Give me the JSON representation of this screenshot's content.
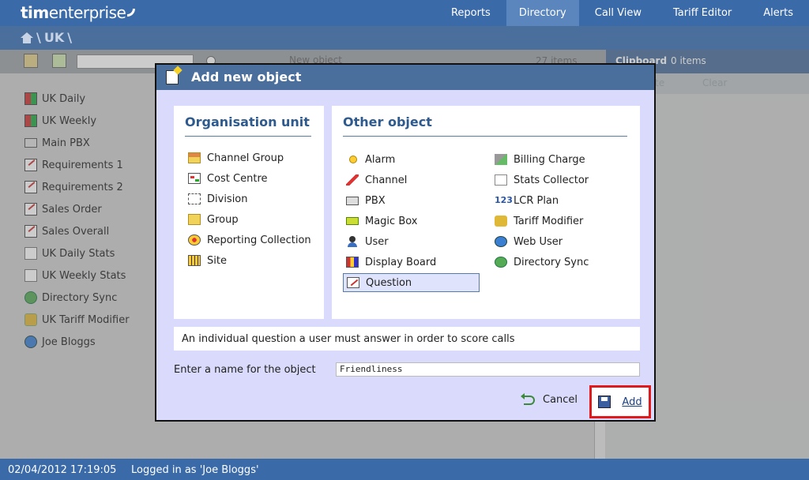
{
  "app": {
    "logo_bold": "tim",
    "logo_light": "enterprise"
  },
  "nav": [
    {
      "label": "Reports",
      "active": false
    },
    {
      "label": "Directory",
      "active": true
    },
    {
      "label": "Call View",
      "active": false
    },
    {
      "label": "Tariff Editor",
      "active": false
    },
    {
      "label": "Alerts",
      "active": false
    }
  ],
  "breadcrumb": {
    "separator1": "\\",
    "current": "UK",
    "separator2": "\\"
  },
  "toolbar": {
    "new_object_label": "New object",
    "item_count": "27 items"
  },
  "clipboard": {
    "title": "Clipboard",
    "count": "0 items",
    "paste_label": "te",
    "clear_label": "Clear"
  },
  "directory_list": [
    {
      "label": "UK Daily",
      "icon": "display-board-icon"
    },
    {
      "label": "UK Weekly",
      "icon": "display-board-icon"
    },
    {
      "label": "Main PBX",
      "icon": "pbx-icon"
    },
    {
      "label": "Requirements 1",
      "icon": "question-icon"
    },
    {
      "label": "Requirements 2",
      "icon": "question-icon"
    },
    {
      "label": "Sales Order",
      "icon": "question-icon"
    },
    {
      "label": "Sales Overall",
      "icon": "question-icon"
    },
    {
      "label": "UK Daily Stats",
      "icon": "stats-icon"
    },
    {
      "label": "UK Weekly Stats",
      "icon": "stats-icon"
    },
    {
      "label": "Directory Sync",
      "icon": "sync-icon"
    },
    {
      "label": "UK Tariff Modifier",
      "icon": "tariff-icon"
    },
    {
      "label": "Joe Bloggs",
      "icon": "globe-icon"
    }
  ],
  "dialog": {
    "title": "Add new object",
    "org_title": "Organisation unit",
    "org_items": [
      "Channel Group",
      "Cost Centre",
      "Division",
      "Group",
      "Reporting Collection",
      "Site"
    ],
    "other_title": "Other object",
    "other_col1": [
      "Alarm",
      "Channel",
      "PBX",
      "Magic Box",
      "User",
      "Display Board",
      "Question"
    ],
    "other_col2": [
      "Billing Charge",
      "Stats Collector",
      "LCR Plan",
      "Tariff Modifier",
      "Web User",
      "Directory Sync"
    ],
    "selected": "Question",
    "description": "An individual question a user must answer in order to score calls",
    "name_label": "Enter a name for the object",
    "name_value": "Friendliness",
    "cancel_label": "Cancel",
    "add_label": "Add"
  },
  "status": {
    "datetime": "02/04/2012 17:19:05",
    "logged_in": "Logged in as 'Joe Bloggs'"
  },
  "colors": {
    "nav_bg": "#3b6aa8",
    "dialog_bg": "#d9dafc",
    "highlight": "#e0191d",
    "title_blue": "#2e5a8e"
  }
}
